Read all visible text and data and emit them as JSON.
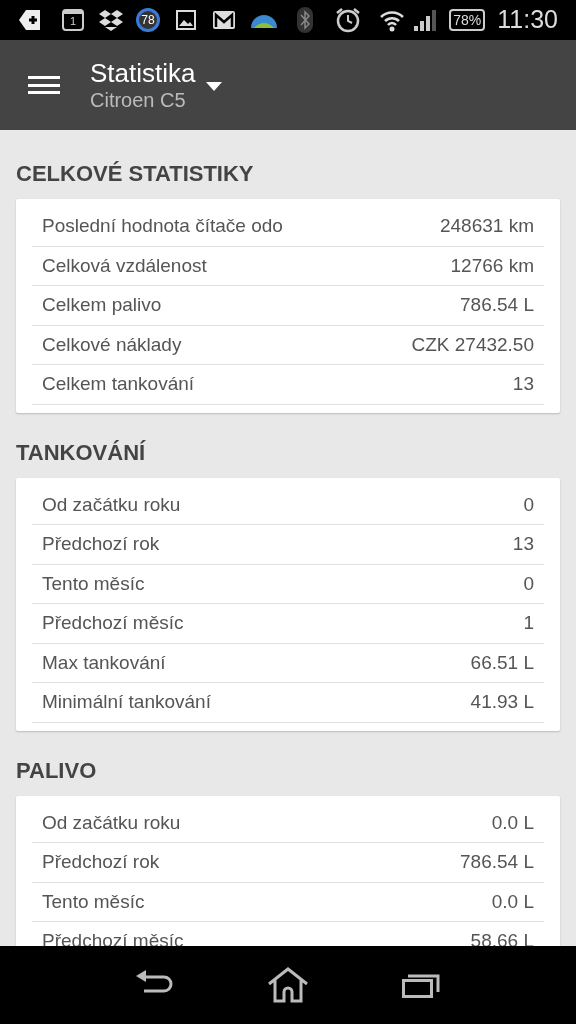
{
  "status_bar": {
    "calendar_day": "1",
    "badge": "78",
    "battery": "78%",
    "time": "11:30"
  },
  "app_bar": {
    "title": "Statistika",
    "subtitle": "Citroen C5"
  },
  "sections": [
    {
      "title": "CELKOVÉ STATISTIKY",
      "rows": [
        {
          "label": "Poslední hodnota čítače odo",
          "value": "248631 km"
        },
        {
          "label": "Celková vzdálenost",
          "value": "12766 km"
        },
        {
          "label": "Celkem palivo",
          "value": "786.54 L"
        },
        {
          "label": "Celkové náklady",
          "value": "CZK 27432.50"
        },
        {
          "label": "Celkem tankování",
          "value": "13"
        }
      ]
    },
    {
      "title": "TANKOVÁNÍ",
      "rows": [
        {
          "label": "Od začátku roku",
          "value": "0"
        },
        {
          "label": "Předchozí rok",
          "value": "13"
        },
        {
          "label": "Tento měsíc",
          "value": "0"
        },
        {
          "label": "Předchozí měsíc",
          "value": "1"
        },
        {
          "label": "Max tankování",
          "value": "66.51 L"
        },
        {
          "label": "Minimální tankování",
          "value": "41.93 L"
        }
      ]
    },
    {
      "title": "PALIVO",
      "rows": [
        {
          "label": "Od začátku roku",
          "value": "0.0 L"
        },
        {
          "label": "Předchozí rok",
          "value": "786.54 L"
        },
        {
          "label": "Tento měsíc",
          "value": "0.0 L"
        },
        {
          "label": "Předchozí měsíc",
          "value": "58.66 L"
        }
      ]
    }
  ]
}
